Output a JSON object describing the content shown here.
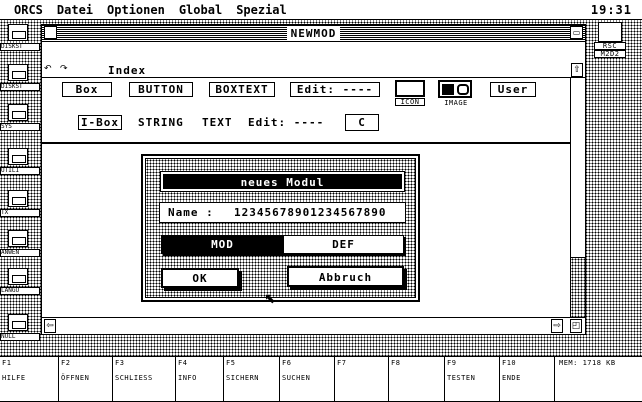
{
  "menu": {
    "items": [
      "ORCS",
      "Datei",
      "Optionen",
      "Global",
      "Spezial"
    ],
    "clock": "19:31"
  },
  "window": {
    "title": "NEWMOD"
  },
  "info_bar": {
    "title": "Index"
  },
  "palette": {
    "row1": [
      "Box",
      "BUTTON",
      "BOXTEXT",
      "Edit: ----",
      "User"
    ],
    "icon_label": "ICON",
    "image_label": "IMAGE",
    "row2": [
      "I-Box",
      "STRING",
      "TEXT",
      "Edit: ----",
      "C"
    ]
  },
  "dialog": {
    "title": "neues Modul",
    "name_label": "Name :",
    "name_value": "12345678901234567890",
    "toggle": {
      "left": "MOD",
      "right": "DEF",
      "selected": "MOD"
    },
    "ok": "OK",
    "cancel": "Abbruch"
  },
  "sidebar": {
    "labels": [
      "DISKST",
      "DISKST",
      "SYS",
      "UTILI",
      "TX",
      "ANWEN",
      "LANGU",
      "NULL"
    ]
  },
  "desktop_icon": {
    "label": "RSC",
    "sublabel": "M2D2"
  },
  "function_keys": [
    {
      "key": "F1",
      "label": "HILFE"
    },
    {
      "key": "F2",
      "label": "ÖFFNEN"
    },
    {
      "key": "F3",
      "label": "SCHLIESS"
    },
    {
      "key": "F4",
      "label": "INFO"
    },
    {
      "key": "F5",
      "label": "SICHERN"
    },
    {
      "key": "F6",
      "label": "SUCHEN"
    },
    {
      "key": "F7",
      "label": ""
    },
    {
      "key": "F8",
      "label": ""
    },
    {
      "key": "F9",
      "label": "TESTEN"
    },
    {
      "key": "F10",
      "label": "ENDE"
    }
  ],
  "memory": "MEM: 1718 KB"
}
